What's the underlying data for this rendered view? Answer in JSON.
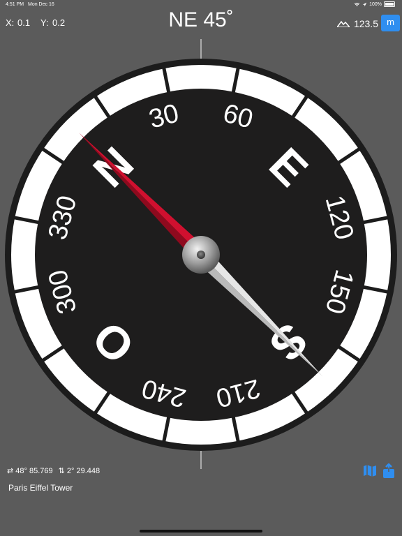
{
  "status_bar": {
    "time": "4:51 PM",
    "date": "Mon Dec 16",
    "battery": "100%"
  },
  "header": {
    "x_label": "X:",
    "x_value": "0.1",
    "y_label": "Y:",
    "y_value": "0.2",
    "heading": "NE 45˚",
    "altitude": "123.5",
    "unit_button": "m"
  },
  "compass": {
    "heading_degrees": 45,
    "labels": [
      {
        "text": "N",
        "bearing": 0,
        "kind": "cardinal"
      },
      {
        "text": "30",
        "bearing": 30,
        "kind": "number"
      },
      {
        "text": "60",
        "bearing": 60,
        "kind": "number"
      },
      {
        "text": "E",
        "bearing": 90,
        "kind": "cardinal"
      },
      {
        "text": "120",
        "bearing": 120,
        "kind": "number"
      },
      {
        "text": "150",
        "bearing": 150,
        "kind": "number"
      },
      {
        "text": "S",
        "bearing": 180,
        "kind": "cardinal"
      },
      {
        "text": "210",
        "bearing": 210,
        "kind": "number"
      },
      {
        "text": "240",
        "bearing": 240,
        "kind": "number"
      },
      {
        "text": "O",
        "bearing": 270,
        "kind": "cardinal"
      },
      {
        "text": "300",
        "bearing": 300,
        "kind": "number"
      },
      {
        "text": "330",
        "bearing": 330,
        "kind": "number"
      }
    ],
    "colors": {
      "north_needle": "#c8102e",
      "south_needle": "#d8d8d8",
      "dial": "#1e1d1d",
      "ring": "#ffffff"
    }
  },
  "footer": {
    "longitude": "48° 85.769",
    "latitude": "2° 29.448",
    "place": "Paris Eiffel Tower",
    "icons": [
      "map-icon",
      "share-icon"
    ]
  }
}
